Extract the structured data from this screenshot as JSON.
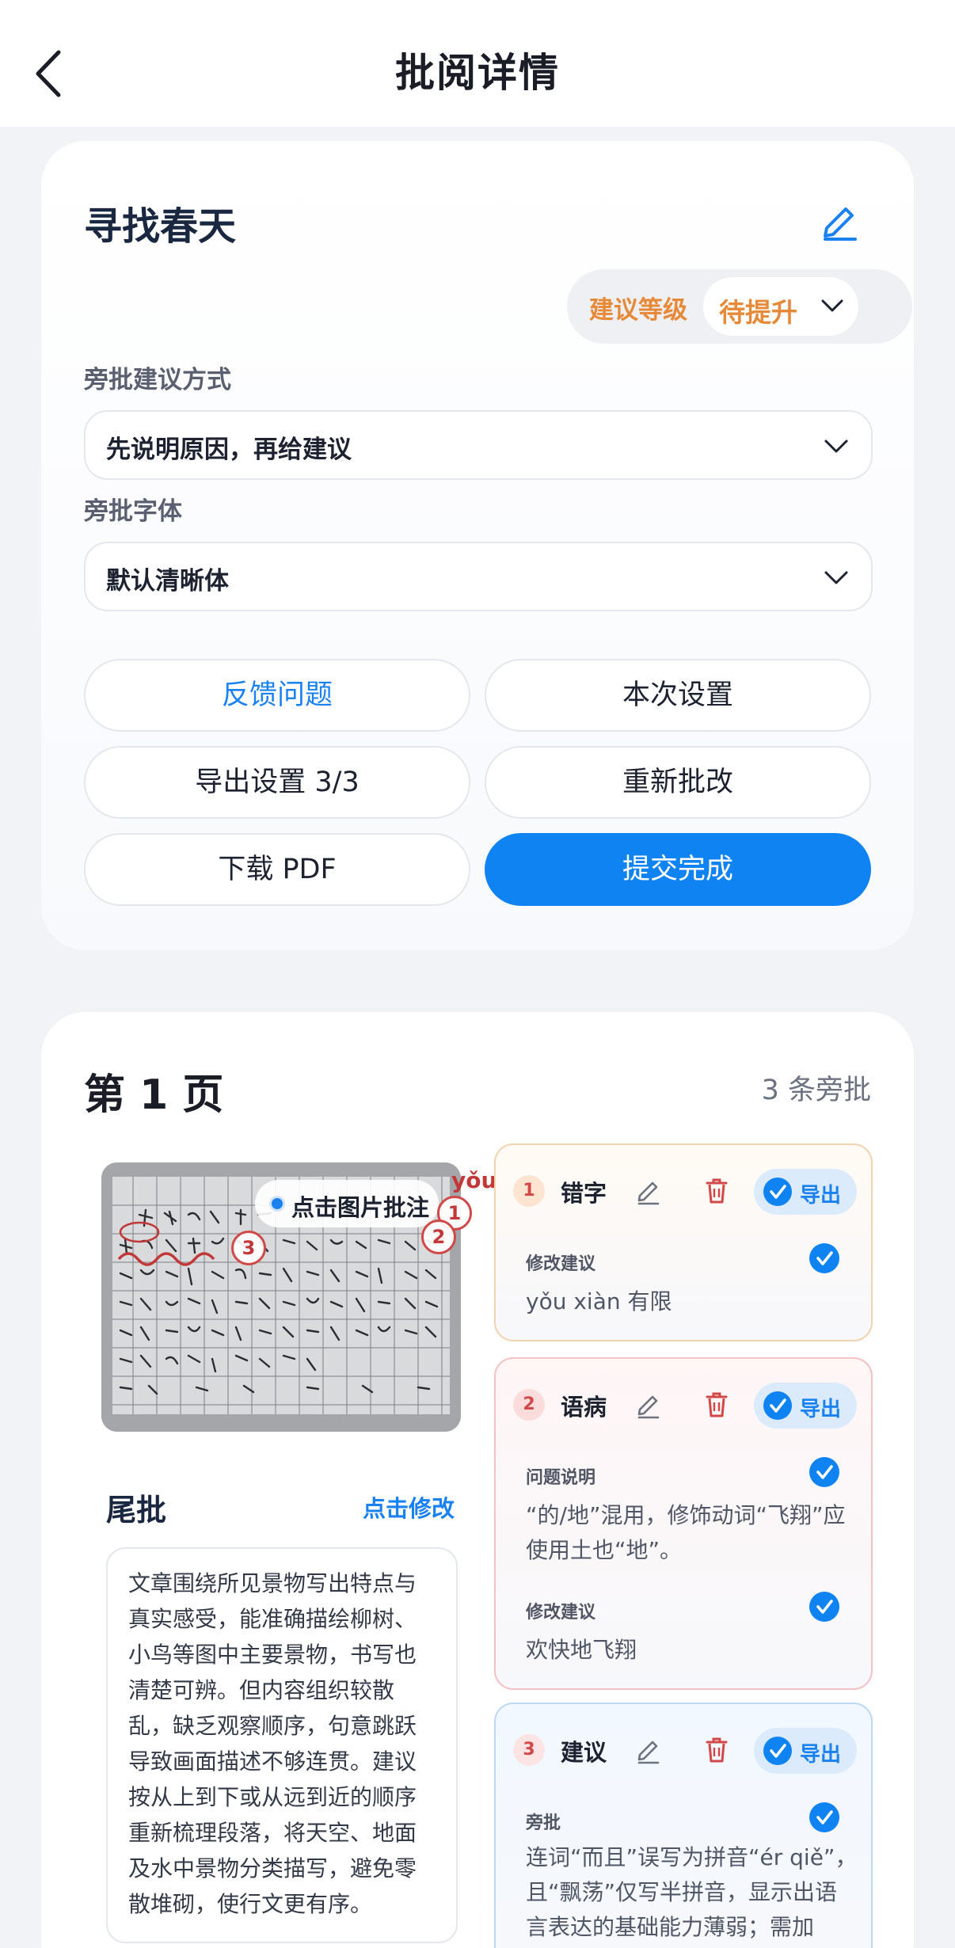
{
  "header": {
    "title": "批阅详情"
  },
  "essay": {
    "title": "寻找春天",
    "grade_label": "建议等级",
    "grade_value": "待提升",
    "method_label": "旁批建议方式",
    "method_value": "先说明原因，再给建议",
    "font_label": "旁批字体",
    "font_value": "默认清晰体"
  },
  "actions": {
    "feedback": "反馈问题",
    "session_settings": "本次设置",
    "export_settings": "导出设置 3/3",
    "regrade": "重新批改",
    "download": "下载 PDF",
    "submit": "提交完成"
  },
  "page": {
    "heading": "第 1 页",
    "annotation_count": "3 条旁批",
    "tap_hint": "点击图片批注",
    "pinyin_mark": "yǒu",
    "pins": [
      "1",
      "2",
      "3"
    ]
  },
  "tail_comment": {
    "title": "尾批",
    "edit_label": "点击修改",
    "lines": [
      "文章围绕所见景物写出特点与",
      "真实感受，能准确描绘柳树、",
      "小鸟等图中主要景物，书写也",
      "清楚可辨。但内容组织较散",
      "乱，缺乏观察顺序，句意跳跃",
      "导致画面描述不够连贯。建议",
      "按从上到下或从远到近的顺序",
      "重新梳理段落，将天空、地面",
      "及水中景物分类描写，避免零",
      "散堆砌，使行文更有序。"
    ]
  },
  "annotations": [
    {
      "number": "1",
      "type": "错字",
      "export_label": "导出",
      "sections": [
        {
          "label": "修改建议",
          "lines": [
            "yǒu xiàn 有限"
          ]
        }
      ]
    },
    {
      "number": "2",
      "type": "语病",
      "export_label": "导出",
      "sections": [
        {
          "label": "问题说明",
          "lines": [
            "“的/地”混用，修饰动词“飞翔”应",
            "使用土也“地”。"
          ]
        },
        {
          "label": "修改建议",
          "lines": [
            "欢快地飞翔"
          ]
        }
      ]
    },
    {
      "number": "3",
      "type": "建议",
      "export_label": "导出",
      "sections": [
        {
          "label": "旁批",
          "lines": [
            "连词“而且”误写为拼音“ér qiě”，",
            "且“飘荡”仅写半拼音，显示出语",
            "言表达的基础能力薄弱；需加"
          ]
        }
      ]
    }
  ],
  "colors": {
    "accent": "#1083f3",
    "grade": "#e68a3a",
    "mark": "#c23838"
  }
}
